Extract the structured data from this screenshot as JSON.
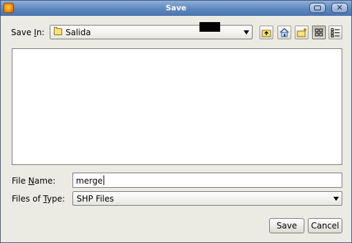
{
  "window": {
    "title": "Save"
  },
  "save_in": {
    "label_prefix": "Save ",
    "label_mnemonic": "I",
    "label_suffix": "n:",
    "value": "Salida",
    "icon": "folder-icon"
  },
  "toolbar": {
    "icons": [
      "up-one-level-icon",
      "home-icon",
      "new-folder-icon",
      "list-view-icon",
      "details-view-icon"
    ]
  },
  "file_name": {
    "label_prefix": "File ",
    "label_mnemonic": "N",
    "label_suffix": "ame:",
    "value": "merge"
  },
  "file_type": {
    "label_prefix": "Files of ",
    "label_mnemonic": "T",
    "label_suffix": "ype:",
    "value": "SHP Files"
  },
  "buttons": {
    "save": "Save",
    "cancel": "Cancel"
  },
  "colors": {
    "titlebar": "#5d86bf",
    "window_bg": "#ecebe3"
  }
}
